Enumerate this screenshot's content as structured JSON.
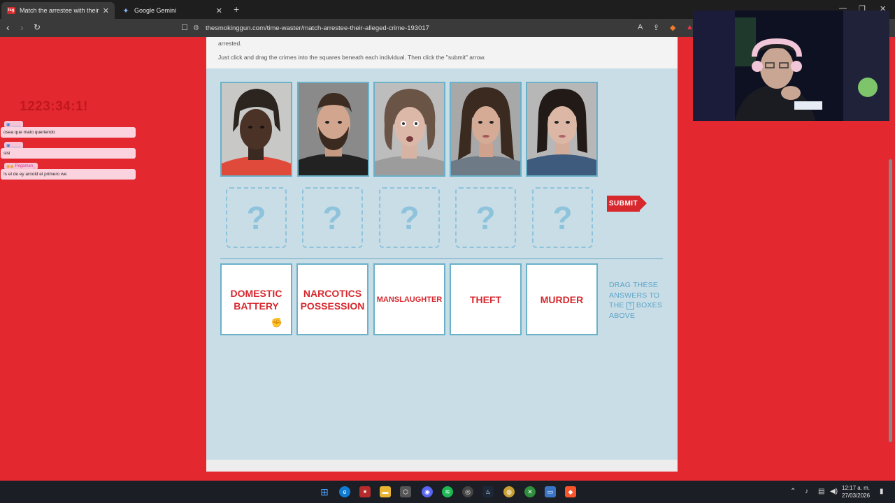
{
  "browser": {
    "tabs": [
      {
        "title": "Match the arrestee with their alleged crime",
        "active": true
      },
      {
        "title": "Google Gemini",
        "active": false
      }
    ],
    "url": "thesmokinggun.com/time-waster/match-arrestee-their-alleged-crime-193017"
  },
  "page": {
    "instruction_line1": "arrested.",
    "instruction_line2": "Just click and drag the crimes into the squares beneath each individual. Then click the \"submit\" arrow.",
    "slot_placeholder": "?",
    "submit_label": "SUBMIT",
    "answers": [
      {
        "line1": "DOMESTIC",
        "line2": "BATTERY"
      },
      {
        "line1": "NARCOTICS",
        "line2": "POSSESSION"
      },
      {
        "line1": "MANSLAUGHTER",
        "line2": ""
      },
      {
        "line1": "THEFT",
        "line2": ""
      },
      {
        "line1": "MURDER",
        "line2": ""
      }
    ],
    "drag_hint": {
      "line1": "DRAG THESE",
      "line2": "ANSWERS TO",
      "line3_pre": "THE",
      "line3_icon": "?",
      "line3_post": "BOXES",
      "line4": "ABOVE"
    }
  },
  "overlay": {
    "timer": "1223:34:1!",
    "chat": [
      {
        "user": "____",
        "message": "osea que mato queriendo"
      },
      {
        "user": "____",
        "message": "sisi"
      },
      {
        "user": "Pegaman_",
        "message": "!s el de ey arnold el primero we"
      }
    ]
  },
  "taskbar": {
    "time": "12:17 a. m.",
    "date": "27/03/2026"
  },
  "colors": {
    "page_red": "#e3292f",
    "panel_blue": "#c9dde6",
    "answer_red": "#d7282e",
    "slot_blue": "#8ec3dc"
  }
}
